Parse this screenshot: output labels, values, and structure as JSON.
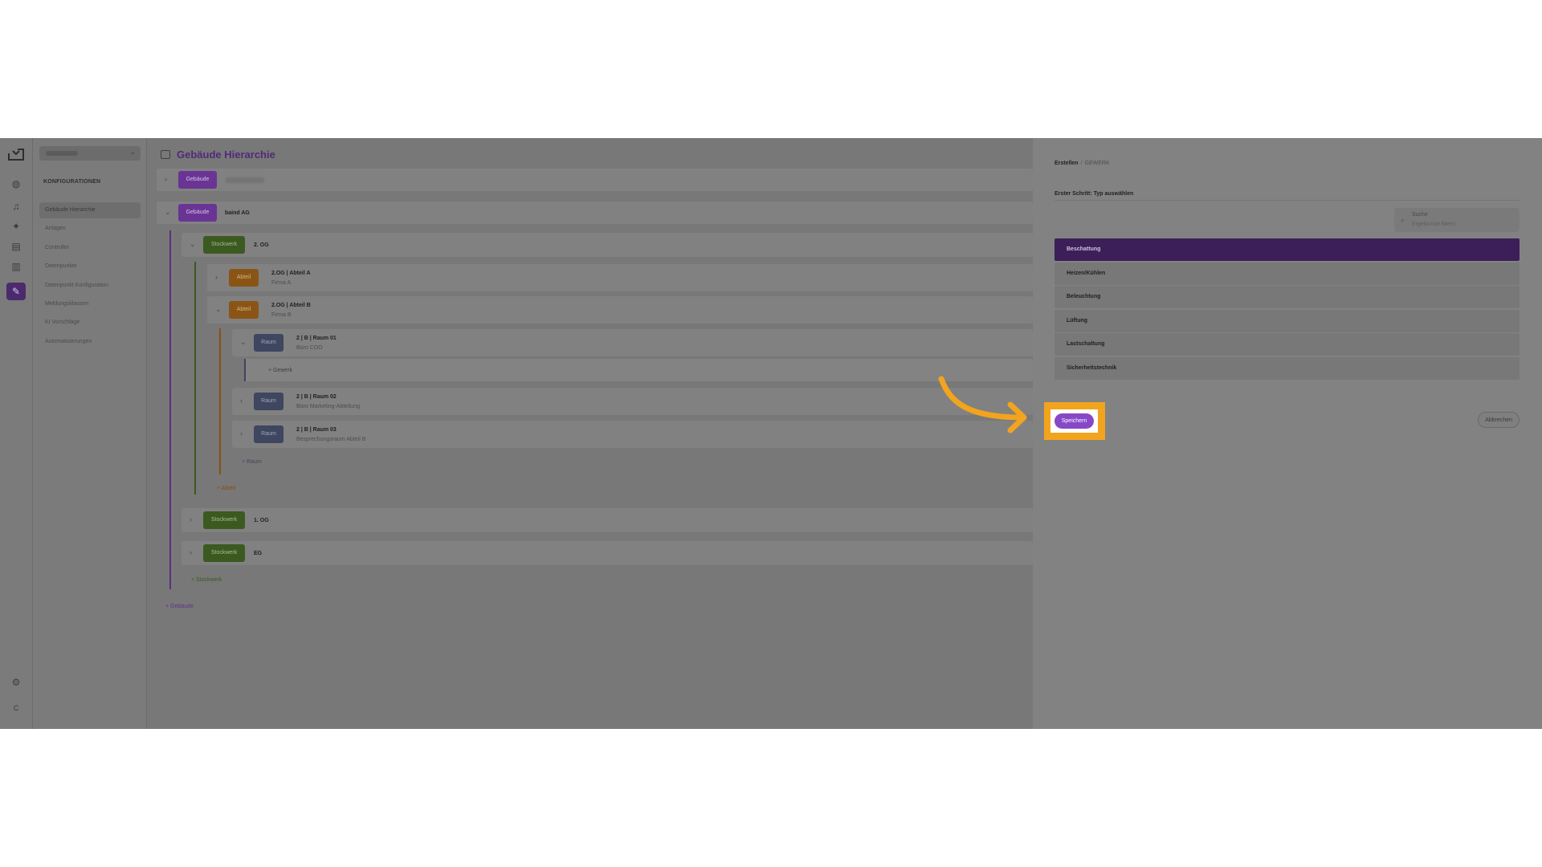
{
  "colors": {
    "accent_purple": "#8748c8",
    "highlight_orange": "#f2a41e",
    "selected_option": "#3c1f58"
  },
  "sidebar": {
    "header": "KONFIGURATIONEN",
    "items": [
      {
        "label": "Gebäude Hierarchie",
        "active": true
      },
      {
        "label": "Anlagen"
      },
      {
        "label": "Controller"
      },
      {
        "label": "Datenpunkte"
      },
      {
        "label": "Datenpunkt Konfiguration"
      },
      {
        "label": "Meldungsklassen"
      },
      {
        "label": "KI Vorschläge"
      },
      {
        "label": "Automatisierungen"
      }
    ],
    "rail_icons": [
      "logo-icon",
      "globe-icon",
      "bell-icon",
      "sparkle-icon",
      "chart-icon",
      "buildings-icon",
      "wrench-icon",
      "settings-icon"
    ],
    "user_initial": "C"
  },
  "main": {
    "title": "Gebäude Hierarchie",
    "tree": {
      "building_badge": "Gebäude",
      "building_name": "baind AG",
      "floor_badge": "Stockwerk",
      "floors": [
        "2. OG",
        "1. OG",
        "EG"
      ],
      "section_badge": "Abteil",
      "sections": [
        {
          "title": "2.OG | Abteil A",
          "subtitle": "Firma A"
        },
        {
          "title": "2.OG | Abteil B",
          "subtitle": "Firma B"
        }
      ],
      "room_badge": "Raum",
      "rooms": [
        {
          "title": "2 | B | Raum 01",
          "subtitle": "Büro COO"
        },
        {
          "title": "2 | B | Raum 02",
          "subtitle": "Büro Marketing-Abteilung"
        },
        {
          "title": "2 | B | Raum 03",
          "subtitle": "Besprechungsraum Abteil B"
        }
      ],
      "add_gewerk": "+ Gewerk",
      "add_raum": "+ Raum",
      "add_abteil": "+ Abteil",
      "add_stockwerk": "+ Stockwerk",
      "add_gebaeude": "+ Gebäude"
    }
  },
  "panel": {
    "breadcrumb": [
      "Erstellen",
      "GEWERK"
    ],
    "breadcrumb_sep": "/",
    "step_label": "Erster Schritt: Typ auswählen",
    "search": {
      "label": "Suche",
      "placeholder": "Ergebnisse filtern"
    },
    "options": [
      "Beschattung",
      "Heizen/Kühlen",
      "Beleuchtung",
      "Lüftung",
      "Lastschaltung",
      "Sicherheitstechnik"
    ],
    "selected_option": "Beschattung",
    "save_label": "Speichern",
    "cancel_label": "Abbrechen"
  }
}
